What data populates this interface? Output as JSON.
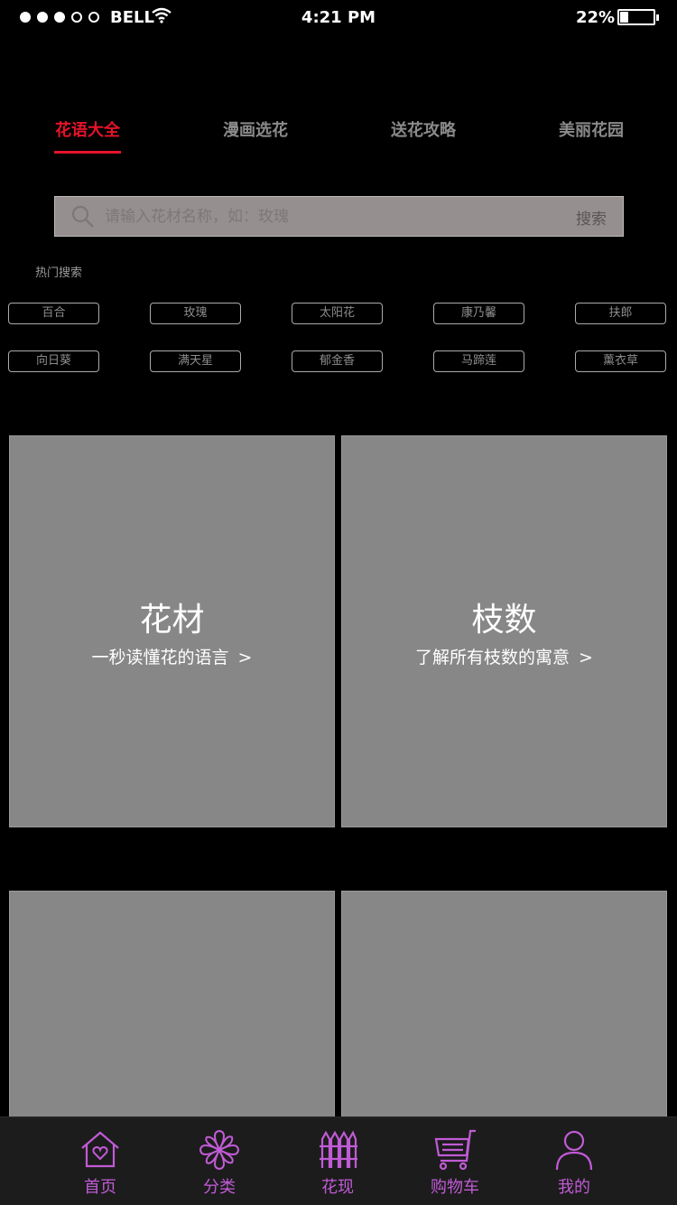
{
  "status_bar": {
    "carrier": "BELL",
    "time": "4:21 PM",
    "battery": "22%"
  },
  "tabs": [
    {
      "label": "花语大全",
      "active": true
    },
    {
      "label": "漫画选花",
      "active": false
    },
    {
      "label": "送花攻略",
      "active": false
    },
    {
      "label": "美丽花园",
      "active": false
    }
  ],
  "search": {
    "placeholder": "请输入花材名称，如：玫瑰",
    "button": "搜索"
  },
  "hot_search": {
    "label": "热门搜索",
    "tags": [
      "百合",
      "玫瑰",
      "太阳花",
      "康乃馨",
      "扶郎",
      "向日葵",
      "满天星",
      "郁金香",
      "马蹄莲",
      "薰衣草"
    ]
  },
  "cards": [
    {
      "title": "花材",
      "subtitle": "一秒读懂花的语言"
    },
    {
      "title": "枝数",
      "subtitle": "了解所有枝数的寓意"
    }
  ],
  "bottom_nav": {
    "items": [
      {
        "label": "首页",
        "icon": "home-heart-icon"
      },
      {
        "label": "分类",
        "icon": "flower-icon"
      },
      {
        "label": "花现",
        "icon": "fence-icon"
      },
      {
        "label": "购物车",
        "icon": "cart-icon"
      },
      {
        "label": "我的",
        "icon": "person-icon"
      }
    ]
  },
  "colors": {
    "accent": "#e5132a",
    "nav_accent": "#c15bd6",
    "card_bg": "#878787"
  }
}
